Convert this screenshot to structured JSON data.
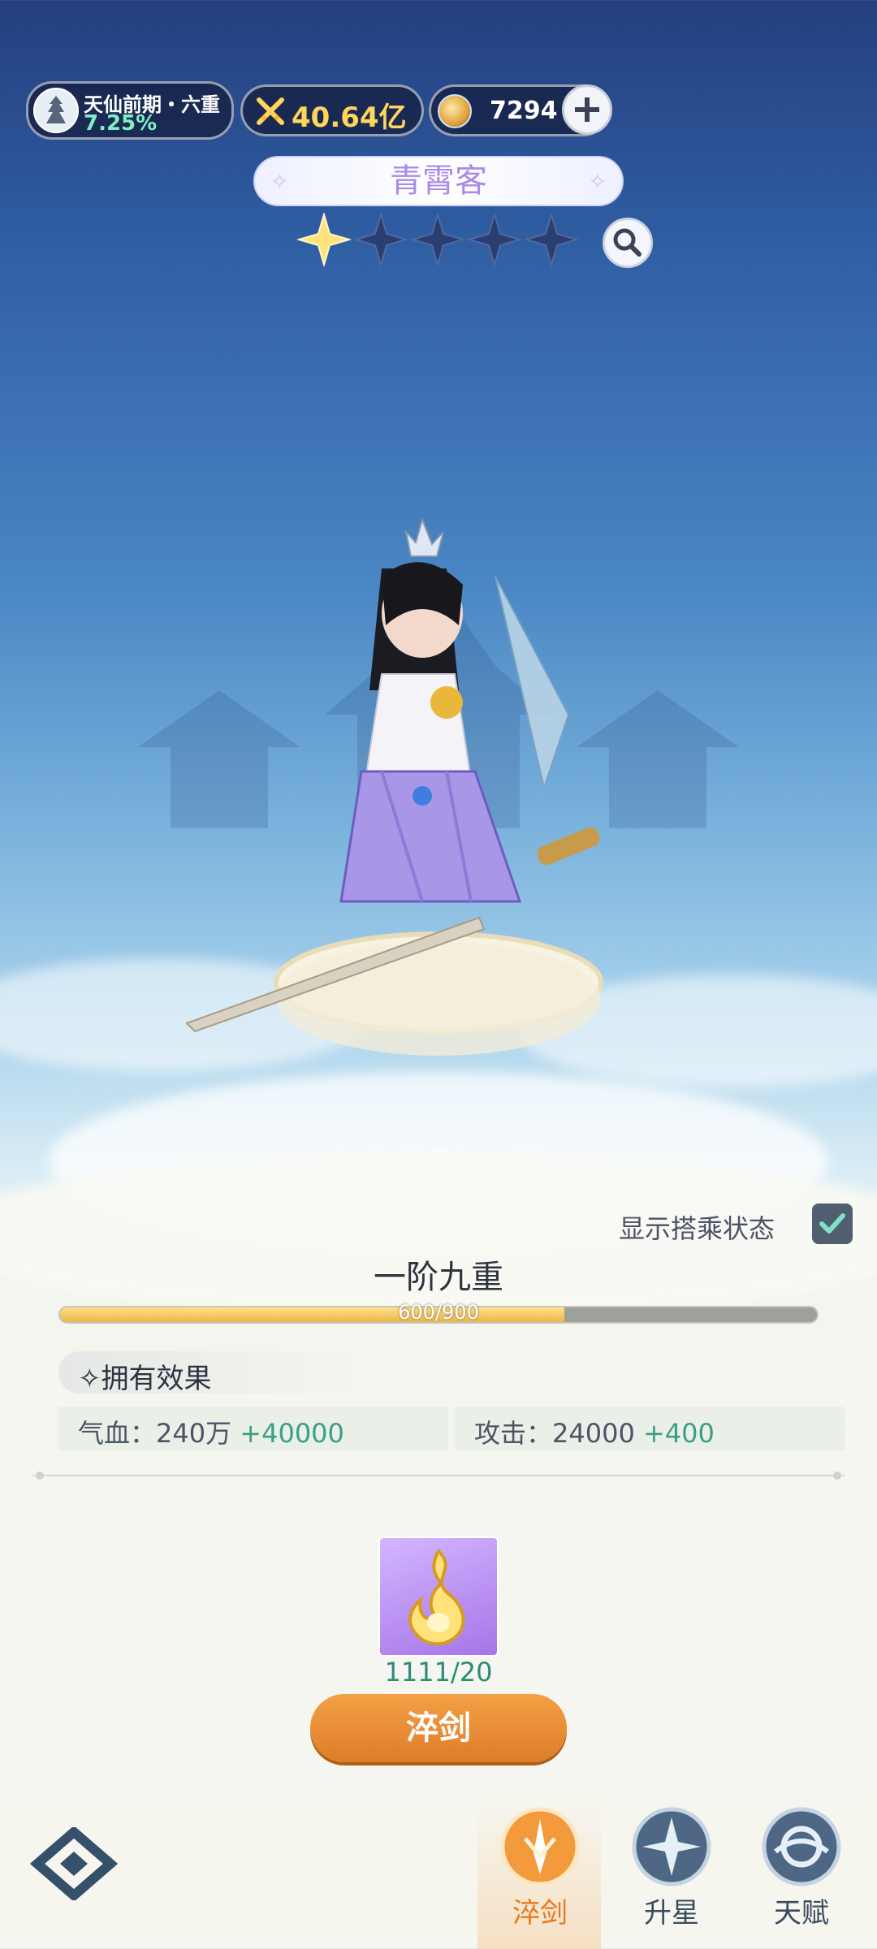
{
  "header": {
    "realm_name": "天仙前期・六重",
    "realm_progress": "7.25%",
    "combat_power": "40.64亿",
    "currency_amount": "7294"
  },
  "character": {
    "name": "青霄客",
    "stars_total": 5,
    "stars_filled": 1
  },
  "panel": {
    "show_mount_label": "显示搭乘状态",
    "show_mount_checked": true,
    "stage_title": "一阶九重",
    "progress_text": "600/900",
    "progress_value": 600,
    "progress_max": 900,
    "effects_label": "拥有效果",
    "stats": [
      {
        "label": "气血：",
        "value": "240万",
        "bonus": "+40000"
      },
      {
        "label": "攻击：",
        "value": "24000",
        "bonus": "+400"
      }
    ],
    "material_count": "1111/20",
    "temper_button": "淬剑"
  },
  "nav": {
    "items": [
      {
        "label": "淬剑",
        "active": true
      },
      {
        "label": "升星",
        "active": false
      },
      {
        "label": "天赋",
        "active": false
      }
    ]
  },
  "colors": {
    "accent_orange": "#e8771f",
    "bonus_green": "#3a9f86",
    "power_gold": "#ffd65a",
    "name_purple": "#a98be6"
  },
  "icons": {
    "realm_avatar": "realm-avatar-icon",
    "power": "crossed-swords-icon",
    "currency": "spirit-coin-icon",
    "add": "plus-icon",
    "search": "magnifier-icon",
    "checkbox": "check-icon",
    "material": "golden-flame-icon",
    "corner": "diamond-menu-icon"
  }
}
